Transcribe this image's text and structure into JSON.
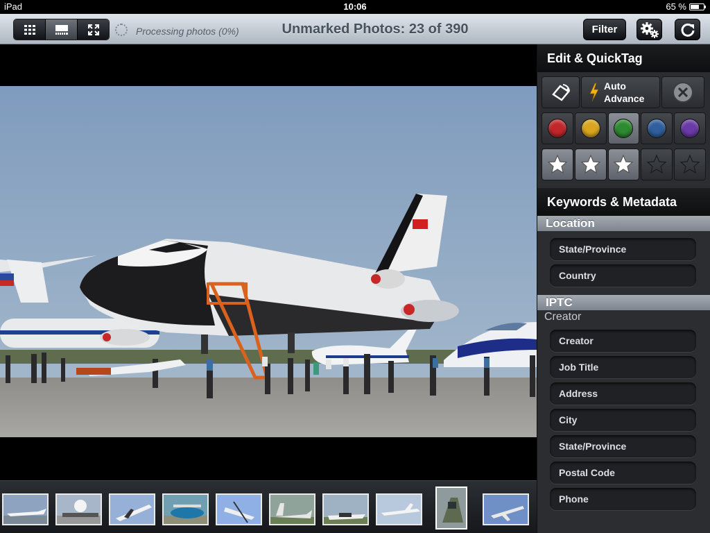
{
  "status_bar": {
    "device": "iPad",
    "time": "10:06",
    "battery": "65 %",
    "battery_level": 0.65
  },
  "toolbar": {
    "processing_text": "Processing photos (0%)",
    "title": "Unmarked Photos: 23 of 390",
    "filter_label": "Filter",
    "view_modes": [
      "grid-icon",
      "filmstrip-icon",
      "fullscreen-icon"
    ],
    "settings_icon": "gears-icon",
    "refresh_icon": "refresh-icon"
  },
  "edit_panel": {
    "title": "Edit & QuickTag",
    "auto_advance_line1": "Auto",
    "auto_advance_line2": "Advance",
    "color_labels": [
      "#c0262b",
      "#d9a51e",
      "#2e8a31",
      "#2f5f9c",
      "#6a3aa6"
    ],
    "selected_color_index": 2,
    "rating": 3,
    "max_rating": 5
  },
  "metadata": {
    "title": "Keywords & Metadata",
    "location": {
      "heading": "Location",
      "fields": [
        "State/Province",
        "Country"
      ]
    },
    "iptc": {
      "heading": "IPTC",
      "subheading": "Creator",
      "fields": [
        "Creator",
        "Job Title",
        "Address",
        "City",
        "State/Province",
        "Postal Code",
        "Phone"
      ]
    }
  },
  "filmstrip": {
    "thumbnail_count": 10,
    "selected_index": 8
  },
  "colors": {
    "sky": "#8ea6c3",
    "tarmac": "#9c9b97",
    "accent_red": "#d21f1f"
  }
}
